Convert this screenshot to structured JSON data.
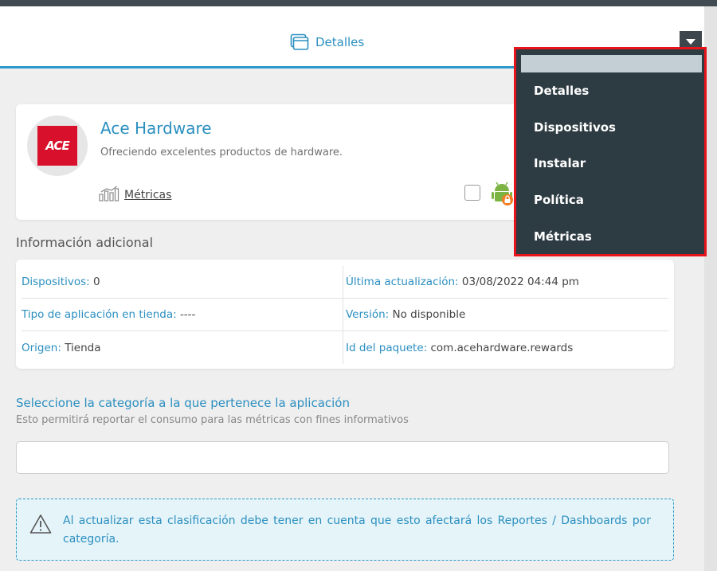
{
  "tabs": {
    "active_label": "Detalles"
  },
  "app": {
    "logo_text": "ACE",
    "name": "Ace Hardware",
    "description": "Ofreciendo excelentes productos de hardware.",
    "metrics_label": "Métricas"
  },
  "info": {
    "title": "Información adicional",
    "rows": [
      {
        "left_key": "Dispositivos:",
        "left_val": "0",
        "right_key": "Última actualización:",
        "right_val": "03/08/2022 04:44 pm"
      },
      {
        "left_key": "Tipo de aplicación en tienda:",
        "left_val": "----",
        "right_key": "Versión:",
        "right_val": "No disponible"
      },
      {
        "left_key": "Origen:",
        "left_val": "Tienda",
        "right_key": "Id del paquete:",
        "right_val": "com.acehardware.rewards"
      }
    ]
  },
  "category": {
    "title": "Seleccione la categoría a la que pertenece la aplicación",
    "subtitle": "Esto permitirá reportar el consumo para las métricas con fines informativos",
    "input_value": ""
  },
  "alert": {
    "text": "Al actualizar esta clasificación debe tener en cuenta que esto afectará los Reportes / Dashboards por categoría."
  },
  "dropdown": {
    "items": [
      "Detalles",
      "Dispositivos",
      "Instalar",
      "Política",
      "Métricas"
    ]
  },
  "colors": {
    "accent": "#2b8fc0",
    "menu_bg": "#2d3b42",
    "highlight": "#e8141b",
    "logo_red": "#d8102b"
  }
}
